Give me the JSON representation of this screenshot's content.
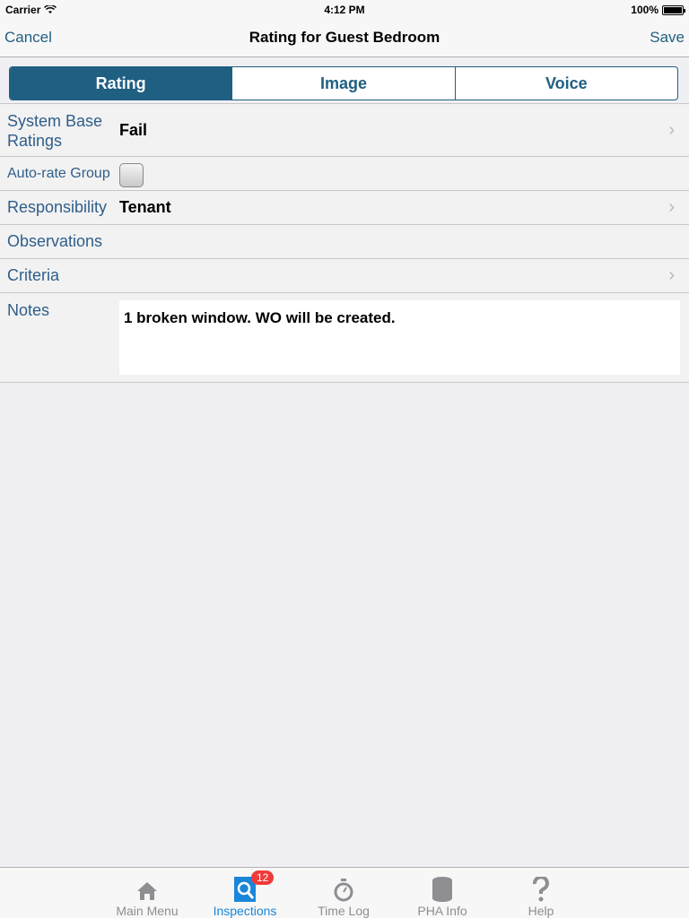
{
  "status_bar": {
    "carrier": "Carrier",
    "time": "4:12 PM",
    "battery": "100%"
  },
  "nav": {
    "cancel": "Cancel",
    "title": "Rating for Guest Bedroom",
    "save": "Save"
  },
  "segments": [
    {
      "label": "Rating",
      "active": true
    },
    {
      "label": "Image",
      "active": false
    },
    {
      "label": "Voice",
      "active": false
    }
  ],
  "form": {
    "system_base_ratings": {
      "label": "System Base Ratings",
      "value": "Fail"
    },
    "auto_rate_group": {
      "label": "Auto-rate Group",
      "checked": false
    },
    "responsibility": {
      "label": "Responsibility",
      "value": "Tenant"
    },
    "observations": {
      "label": "Observations"
    },
    "criteria": {
      "label": "Criteria"
    },
    "notes": {
      "label": "Notes",
      "value": "1 broken window. WO will be created."
    }
  },
  "tabs": [
    {
      "label": "Main Menu",
      "icon": "home-icon"
    },
    {
      "label": "Inspections",
      "icon": "inspections-icon",
      "badge": "12",
      "active": true
    },
    {
      "label": "Time Log",
      "icon": "stopwatch-icon"
    },
    {
      "label": "PHA Info",
      "icon": "database-icon"
    },
    {
      "label": "Help",
      "icon": "help-icon"
    }
  ],
  "colors": {
    "accent": "#1f5f82",
    "tab_active": "#1a86d9",
    "badge": "#f03b3b"
  }
}
